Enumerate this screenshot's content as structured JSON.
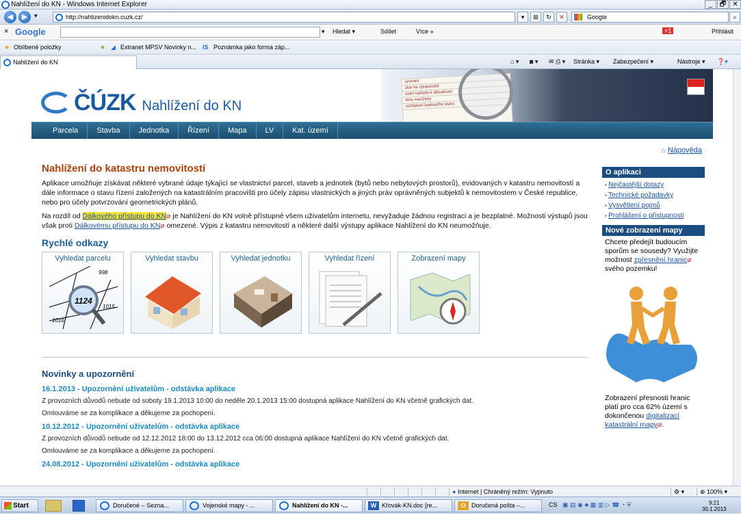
{
  "window": {
    "title": "Nahlížení do KN - Windows Internet Explorer",
    "buttons": [
      "_",
      "🗗",
      "✕"
    ]
  },
  "address": {
    "url": "http://nahlizenidokn.cuzk.cz/",
    "search_engine": "Google"
  },
  "google_bar": {
    "brand": "Google",
    "search": "Hledat ▾",
    "share": "Sdílet",
    "more": "Více »",
    "login": "Přihlásit",
    "gplus": "+1"
  },
  "favorites": {
    "label": "Oblíbené položky",
    "items": [
      "Extranet MPSV  Novinky n...",
      "Poznámka jako forma záp..."
    ]
  },
  "tab": {
    "title": "Nahlížení do KN"
  },
  "commands": [
    "Stránka ▾",
    "Zabezpečení ▾",
    "Nástroje ▾"
  ],
  "banner": {
    "brand": "ČÚZK",
    "subtitle": "Nahlížení do KN",
    "paper_lines": [
      "uzování",
      "úlav ke zpracování",
      "ostní výkladu k aktualizaci",
      "ému navrženy",
      "ozhlášení budoucího stavu"
    ]
  },
  "nav": [
    "Parcela",
    "Stavba",
    "Jednotka",
    "Řízení",
    "Mapa",
    "LV",
    "Kat. území"
  ],
  "help": "Nápověda",
  "main": {
    "title": "Nahlížení do katastru nemovitostí",
    "para1": "Aplikace umožňuje získávat některé vybrané údaje týkající se vlastnictví parcel, staveb a jednotek (bytů nebo nebytových prostorů), evidovaných v katastru nemovitostí a dále informace o stavu řízení založených na katastrálním pracovišti pro účely zápisu vlastnických a jiných práv oprávněných subjektů k nemovitostem v České republice, nebo pro účely potvrzování geometrických plánů.",
    "p2_a": "Na rozdíl od ",
    "p2_link": "Dálkového přístupu do KN",
    "p2_b": " je Nahlížení do KN volně přístupné všem uživatelům internetu, nevyžaduje žádnou registraci a je bezplatné. Možnosti výstupů jsou však proti ",
    "p2_link2": "Dálkovému přístupu do KN",
    "p2_c": " omezené. Výpis z katastru nemovitostí a některé další výstupy aplikace Nahlížení do KN neumožňuje.",
    "quick_title": "Rychlé odkazy",
    "tiles": [
      "Vyhledat parcelu",
      "Vyhledat stavbu",
      "Vyhledat jednotku",
      "Vyhledat řízení",
      "Zobrazení mapy"
    ],
    "parcel_numbers": [
      "998",
      "1124",
      "1015",
      "1016"
    ]
  },
  "news": {
    "title": "Novinky a upozornění",
    "items": [
      {
        "head": "16.1.2013 - Upozornění uživatelům - odstávka aplikace",
        "p1": "Z provozních důvodů nebude od soboty 19.1.2013 10:00 do neděle 20.1.2013 15:00 dostupná aplikace Nahlížení do KN včetně grafických dat.",
        "p2": "Omlouváme se za komplikace a děkujeme za pochopení."
      },
      {
        "head": "10.12.2012 - Upozornění uživatelům - odstávka aplikace",
        "p1": "Z provozních důvodů nebude od 12.12.2012 18:00 do 13.12.2012 cca 06:00 dostupná aplikace Nahlížení do KN včetně grafických dat.",
        "p2": "Omlouváme se za komplikace a děkujeme za pochopení."
      },
      {
        "head": "24.08.2012 - Upozornění uživatelům - odstávka aplikace"
      }
    ]
  },
  "sidebar": {
    "about_title": "O aplikaci",
    "links": [
      "Nejčastější dotazy",
      "Technické požadavky",
      "Vysvětlení pojmů",
      "Prohlášení o přístupnosti"
    ],
    "map_title": "Nové zobrazení mapy",
    "map_text_a": "Chcete předejít budoucím sporům se sousedy? Využijte možnost ",
    "map_link": "zpřesnění hranic",
    "map_text_b": " svého pozemku!",
    "acc_text_a": "Zobrazení přesnosti hranic platí pro cca 62% území s dokončenou ",
    "acc_link": "digitalizací katastrální mapy",
    "acc_text_b": "."
  },
  "status": {
    "zone": "Internet | Chráněný režim: Vypnuto",
    "zoom": "100%"
  },
  "taskbar": {
    "start": "Start",
    "items": [
      "Doručené – Sezna...",
      "Vojenské mapy - ...",
      "Nahlížení do KN -...",
      "Křovák-KN.doc [re...",
      "Doručená pošta –..."
    ],
    "lang": "CS",
    "time": "9:21",
    "date": "30.1.2013"
  }
}
